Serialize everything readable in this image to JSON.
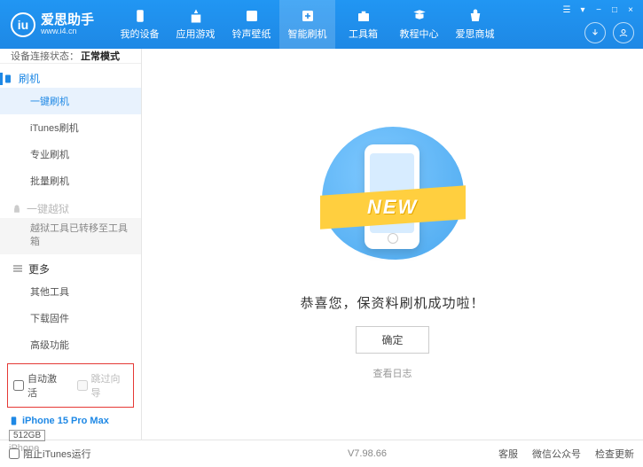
{
  "app": {
    "name": "爱思助手",
    "url": "www.i4.cn"
  },
  "nav": {
    "items": [
      {
        "label": "我的设备"
      },
      {
        "label": "应用游戏"
      },
      {
        "label": "铃声壁纸"
      },
      {
        "label": "智能刷机"
      },
      {
        "label": "工具箱"
      },
      {
        "label": "教程中心"
      },
      {
        "label": "爱思商城"
      }
    ]
  },
  "status": {
    "label": "设备连接状态：",
    "value": "正常模式"
  },
  "sidebar": {
    "flash": {
      "title": "刷机",
      "items": [
        "一键刷机",
        "iTunes刷机",
        "专业刷机",
        "批量刷机"
      ]
    },
    "jailbreak": {
      "title": "一键越狱",
      "note": "越狱工具已转移至工具箱"
    },
    "more": {
      "title": "更多",
      "items": [
        "其他工具",
        "下载固件",
        "高级功能"
      ]
    },
    "options": {
      "auto_activate": "自动激活",
      "skip_guide": "跳过向导"
    }
  },
  "device": {
    "name": "iPhone 15 Pro Max",
    "capacity": "512GB",
    "type": "iPhone"
  },
  "main": {
    "ribbon": "NEW",
    "success": "恭喜您，保资料刷机成功啦！",
    "ok": "确定",
    "log": "查看日志"
  },
  "footer": {
    "block_itunes": "阻止iTunes运行",
    "version": "V7.98.66",
    "links": [
      "客服",
      "微信公众号",
      "检查更新"
    ]
  }
}
